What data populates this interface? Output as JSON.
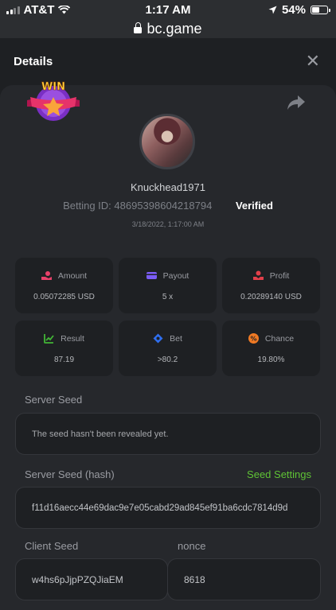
{
  "statusbar": {
    "carrier": "AT&T",
    "time": "1:17 AM",
    "battery": "54%",
    "battery_level": 0.54
  },
  "browser": {
    "url": "bc.game"
  },
  "header": {
    "title": "Details"
  },
  "bet": {
    "badge_text": "WIN",
    "username": "Knuckhead1971",
    "betting_id_label": "Betting ID: 48695398604218794",
    "verified_label": "Verified",
    "datetime": "3/18/2022, 1:17:00 AM"
  },
  "stats": [
    {
      "label": "Amount",
      "value": "0.05072285 USD",
      "icon": "hand-coin-icon",
      "color": "#e8416a"
    },
    {
      "label": "Payout",
      "value": "5 x",
      "icon": "wallet-card-icon",
      "color": "#7b5cf5"
    },
    {
      "label": "Profit",
      "value": "0.20289140 USD",
      "icon": "hand-money-icon",
      "color": "#e2404a"
    },
    {
      "label": "Result",
      "value": "87.19",
      "icon": "chart-check-icon",
      "color": "#42b536"
    },
    {
      "label": "Bet",
      "value": ">80.2",
      "icon": "ticket-icon",
      "color": "#2f6ff0"
    },
    {
      "label": "Chance",
      "value": "19.80%",
      "icon": "percent-icon",
      "color": "#f07a24"
    }
  ],
  "server_seed": {
    "label": "Server Seed",
    "value": "The seed hasn't been revealed yet."
  },
  "server_seed_hash": {
    "label": "Server Seed (hash)",
    "link": "Seed Settings",
    "value": "f11d16aecc44e69dac9e7e05cabd29ad845ef91ba6cdc7814d9d"
  },
  "client_seed": {
    "label": "Client Seed",
    "value": "w4hs6pJjpPZQJiaEM"
  },
  "nonce": {
    "label": "nonce",
    "value": "8618"
  },
  "colors": {
    "accent_green": "#5fc335",
    "card_bg": "#26282c",
    "page_bg": "#1e2023"
  }
}
